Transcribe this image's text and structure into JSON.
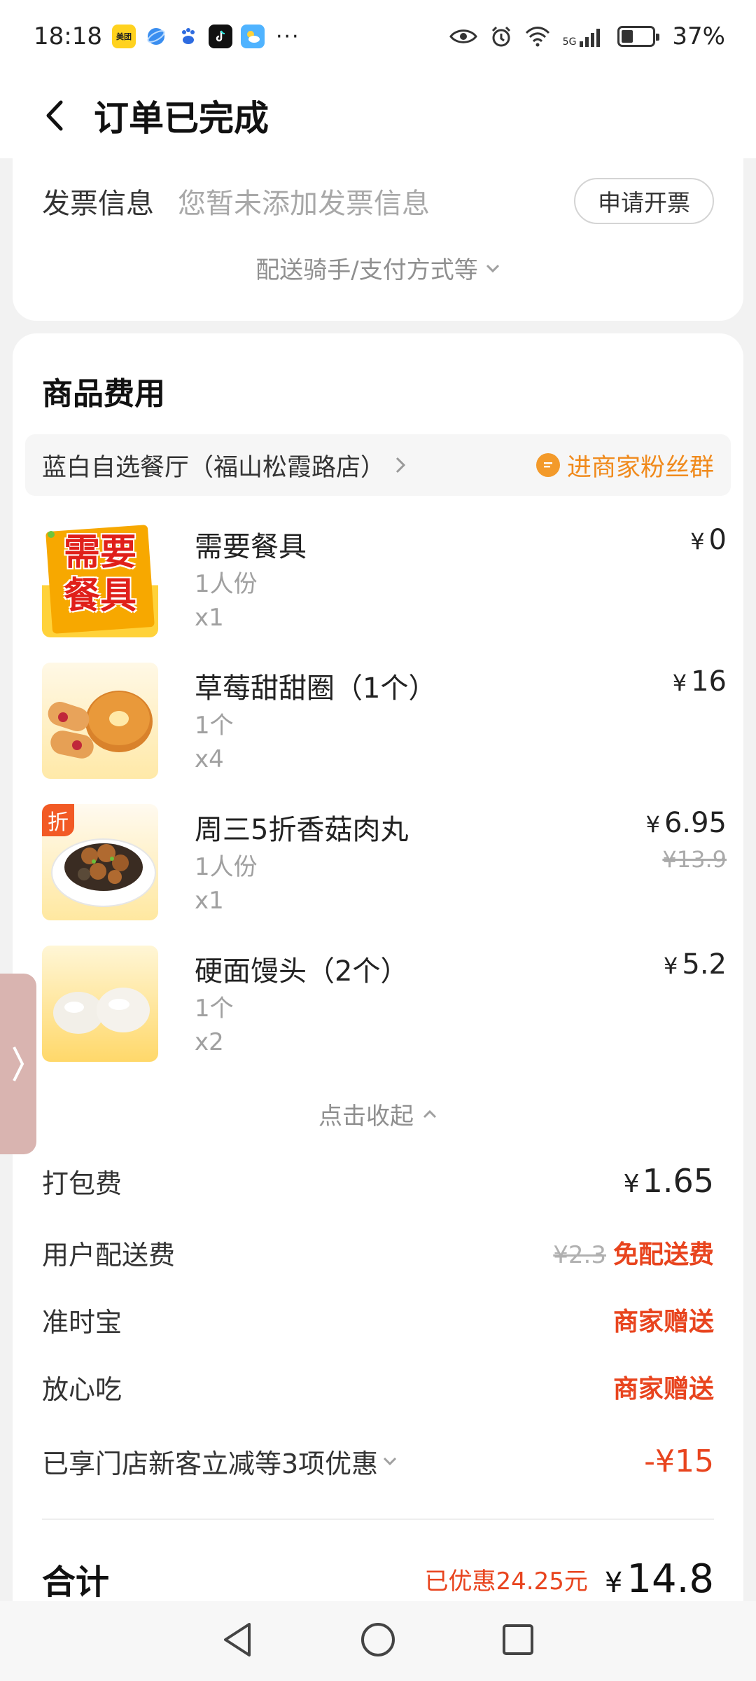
{
  "status_bar": {
    "time": "18:18",
    "apps": [
      "美团",
      "browser-icon",
      "baidu-icon",
      "douyin-icon",
      "weather-icon"
    ],
    "more": "···",
    "battery_level": "37%",
    "signal": "5G"
  },
  "header": {
    "title": "订单已完成"
  },
  "invoice": {
    "label": "发票信息",
    "value": "您暂未添加发票信息",
    "button": "申请开票",
    "more_label": "配送骑手/支付方式等"
  },
  "goods": {
    "section_title": "商品费用",
    "shop_name": "蓝白自选餐厅（福山松霞路店）",
    "fans_label": "进商家粉丝群",
    "items": [
      {
        "name": "需要餐具",
        "spec": "1人份",
        "qty": "x1",
        "price": "0",
        "orig_price": "",
        "badge": ""
      },
      {
        "name": "草莓甜甜圈（1个）",
        "spec": "1个",
        "qty": "x4",
        "price": "16",
        "orig_price": "",
        "badge": ""
      },
      {
        "name": "周三5折香菇肉丸",
        "spec": "1人份",
        "qty": "x1",
        "price": "6.95",
        "orig_price": "¥13.9",
        "badge": "折"
      },
      {
        "name": "硬面馒头（2个）",
        "spec": "1个",
        "qty": "x2",
        "price": "5.2",
        "orig_price": "",
        "badge": ""
      }
    ],
    "thumb_text": {
      "utensils_line1": "需要",
      "utensils_line2": "餐具"
    },
    "collapse_label": "点击收起",
    "currency": "¥"
  },
  "fees": {
    "packing": {
      "label": "打包费",
      "value": "1.65"
    },
    "delivery": {
      "label": "用户配送费",
      "orig": "¥2.3",
      "value": "免配送费"
    },
    "ontime": {
      "label": "准时宝",
      "value": "商家赠送"
    },
    "safe": {
      "label": "放心吃",
      "value": "商家赠送"
    },
    "discount": {
      "label": "已享门店新客立减等3项优惠",
      "value": "-¥15"
    }
  },
  "total": {
    "label": "合计",
    "saved": "已优惠24.25元",
    "value": "14.8"
  },
  "colors": {
    "accent_red": "#e8441e",
    "accent_orange": "#f08a1c",
    "background": "#f2f2f2"
  }
}
